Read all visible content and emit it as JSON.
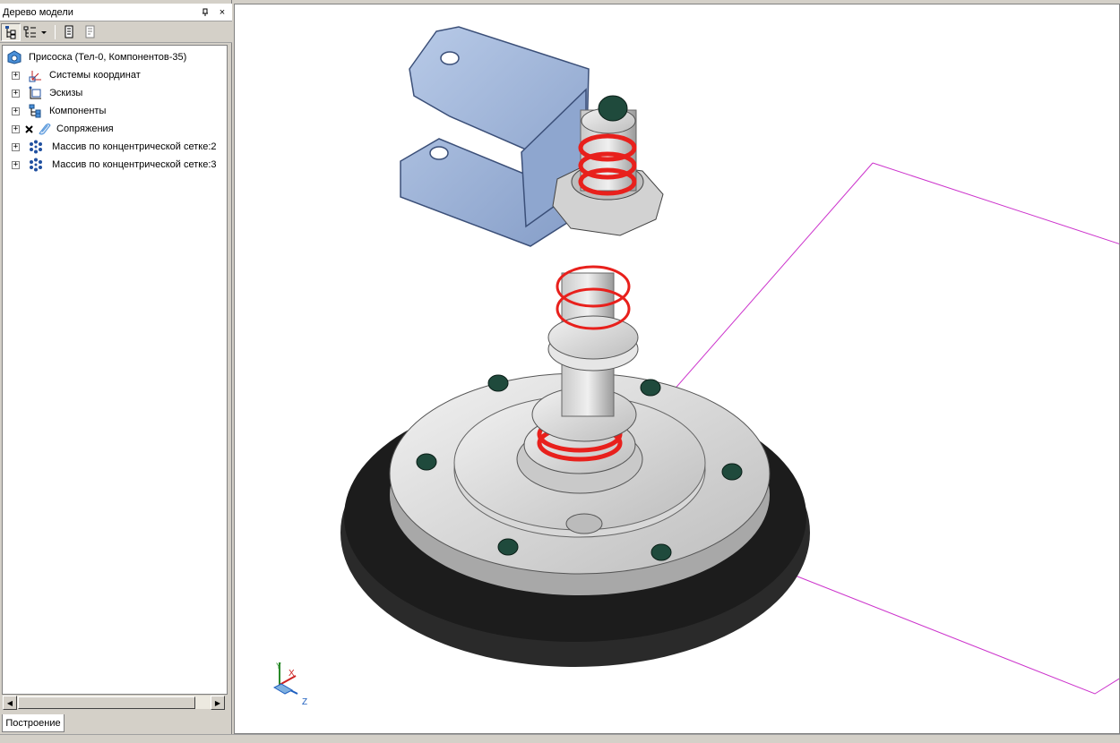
{
  "panel": {
    "title": "Дерево модели",
    "pin_glyph": "ㅍ",
    "close_glyph": "×"
  },
  "tree": {
    "root": "Присоска (Тел-0, Компонентов-35)",
    "items": [
      {
        "label": "Системы координат",
        "icon": "coordinate-system-icon"
      },
      {
        "label": "Эскизы",
        "icon": "sketch-icon"
      },
      {
        "label": "Компоненты",
        "icon": "components-icon"
      },
      {
        "label": "Сопряжения",
        "icon": "mates-icon"
      },
      {
        "label": "Массив по концентрической сетке:2",
        "icon": "circular-array-icon"
      },
      {
        "label": "Массив по концентрической сетке:3",
        "icon": "circular-array-icon"
      }
    ]
  },
  "bottom_tab": "Построение",
  "axes": {
    "x": "X",
    "y": "Y",
    "z": "Z"
  },
  "colors": {
    "bracket": "#9db3d6",
    "spring": "#e8201c",
    "suction_cup": "#2a2a2a",
    "plane": "#cc33cc",
    "nut": "#1f4a3c"
  }
}
